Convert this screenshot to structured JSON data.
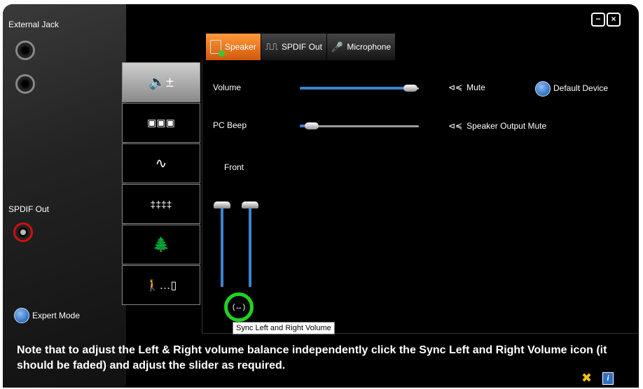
{
  "left_panel": {
    "external_jack_label": "External Jack",
    "spdif_out_label": "SPDIF Out",
    "expert_mode_label": "Expert Mode"
  },
  "window_controls": {
    "minimize": "−",
    "close": "×"
  },
  "tabs": [
    {
      "label": "Speaker",
      "active": true
    },
    {
      "label": "SPDIF Out",
      "active": false
    },
    {
      "label": "Microphone",
      "active": false
    }
  ],
  "speaker": {
    "volume_label": "Volume",
    "volume_level": 0.93,
    "pc_beep_label": "PC Beep",
    "pc_beep_level": 0.1,
    "mute_label": "Mute",
    "speaker_output_mute_label": "Speaker Output Mute",
    "default_device_label": "Default Device",
    "front_label": "Front",
    "left_level": 1.0,
    "right_level": 1.0
  },
  "sync_icon_text": "(↔)",
  "tooltip_text": "Sync Left and Right Volume",
  "note_text": "Note that to adjust the Left & Right volume balance independently click the Sync Left and Right Volume icon (it should be faded) and adjust the slider as required.",
  "colors": {
    "accent_orange": "#e8721c",
    "slider_blue": "#3d82d1",
    "highlight_green": "#21d321"
  }
}
